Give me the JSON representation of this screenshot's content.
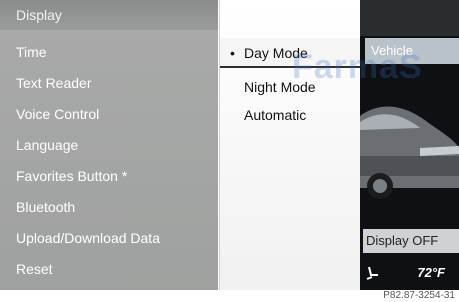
{
  "menu": {
    "header": "Display",
    "items": [
      {
        "label": "Time"
      },
      {
        "label": "Text Reader"
      },
      {
        "label": "Voice Control"
      },
      {
        "label": "Language"
      },
      {
        "label": "Favorites Button *"
      },
      {
        "label": "Bluetooth"
      },
      {
        "label": "Upload/Download Data"
      },
      {
        "label": "Reset"
      }
    ]
  },
  "submenu": {
    "items": [
      {
        "label": "Day Mode",
        "selected": true
      },
      {
        "label": "Night Mode",
        "selected": false
      },
      {
        "label": "Automatic",
        "selected": false
      }
    ]
  },
  "preview": {
    "vehicle_tab": "Vehicle",
    "display_off": "Display OFF",
    "temperature": "72°F"
  },
  "watermark": "FarmaS",
  "figure_code": "P82.87-3254-31",
  "colors": {
    "menu_bg": "#a9aaa9",
    "submenu_bg": "#ffffff",
    "preview_bg": "#0e1013"
  }
}
